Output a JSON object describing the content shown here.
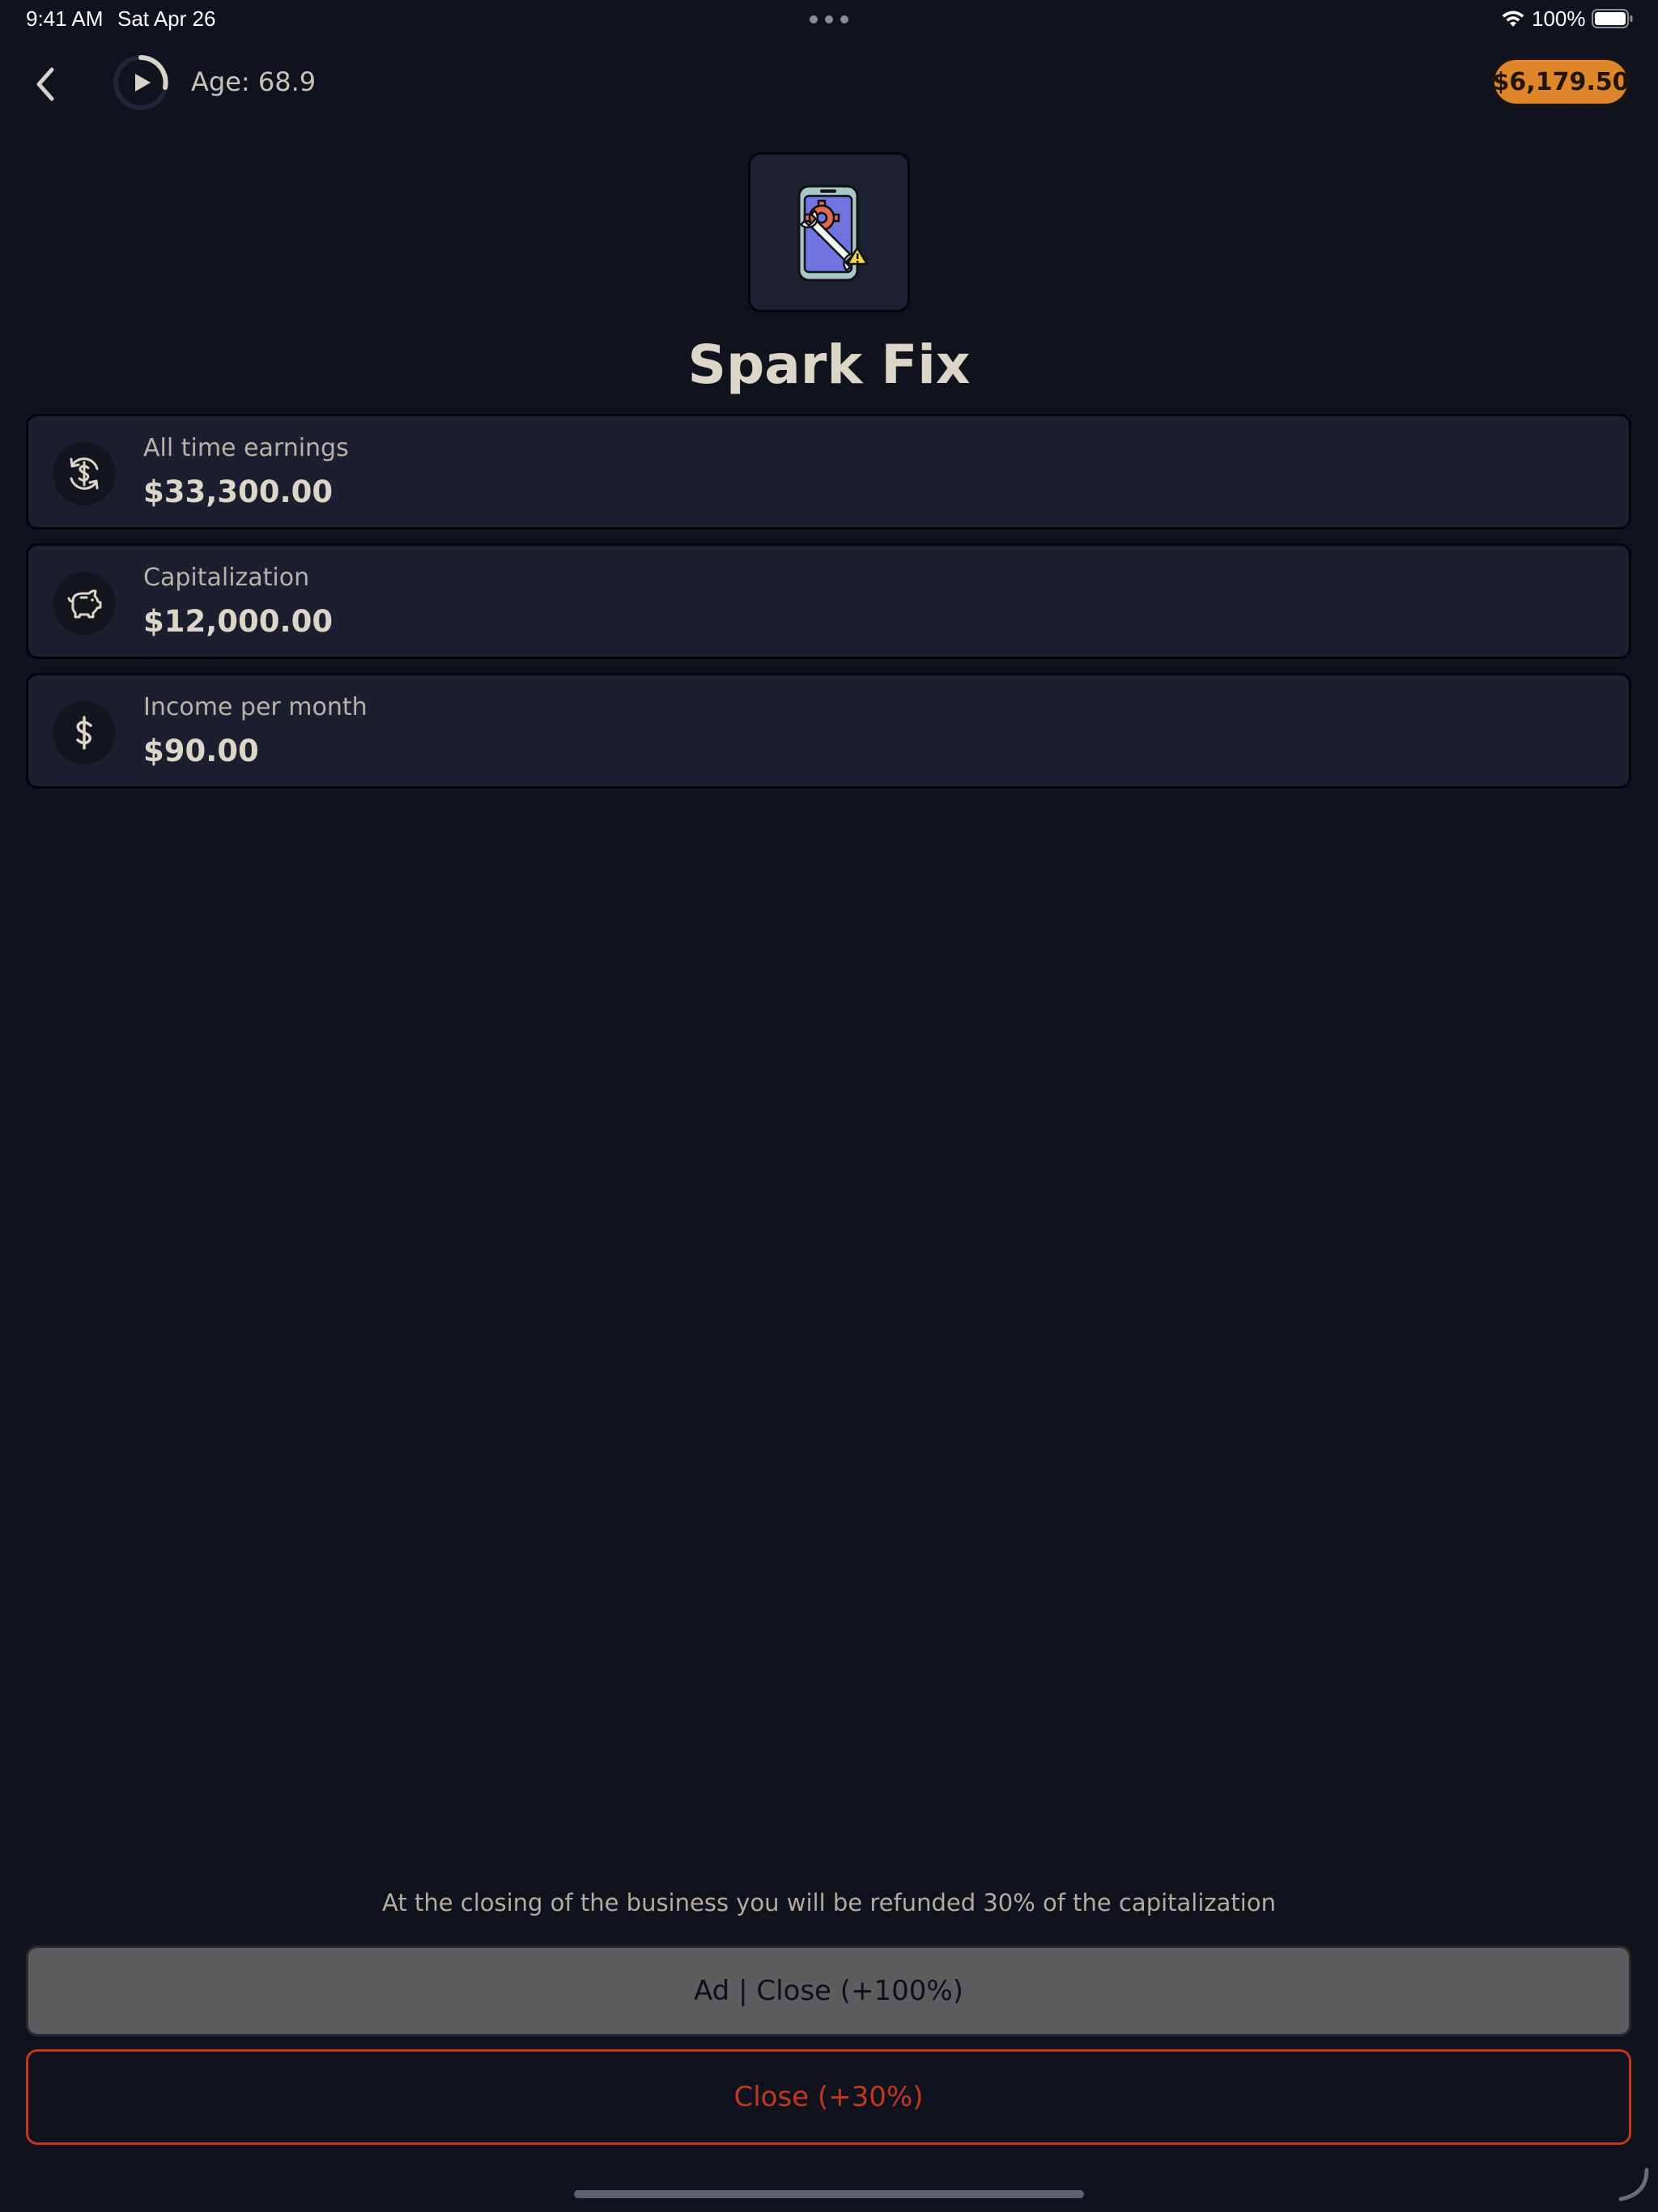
{
  "status_bar": {
    "time": "9:41 AM",
    "date": "Sat Apr 26",
    "battery": "100%",
    "icons": [
      "wifi-icon",
      "battery-icon"
    ]
  },
  "header": {
    "back_icon": "chevron-left-icon",
    "play_icon": "play-progress-icon",
    "age": "Age: 68.9",
    "balance": "$6,179.50"
  },
  "business": {
    "icon": "phone-repair-icon",
    "name": "Spark Fix"
  },
  "stats": [
    {
      "icon": "refresh-dollar-icon",
      "label": "All time earnings",
      "value": "$33,300.00"
    },
    {
      "icon": "piggy-bank-icon",
      "label": "Capitalization",
      "value": "$12,000.00"
    },
    {
      "icon": "dollar-icon",
      "label": "Income per month",
      "value": "$90.00"
    }
  ],
  "footer": {
    "note": "At the closing of the business you will be refunded 30% of the capitalization",
    "ad_close_label": "Ad | Close (+100%)",
    "close_label": "Close (+30%)"
  },
  "colors": {
    "background": "#10121e",
    "card": "#1c1f30",
    "accent_orange": "#e0862a",
    "danger_red": "#c0391f",
    "text_primary": "#ddd5c8"
  }
}
